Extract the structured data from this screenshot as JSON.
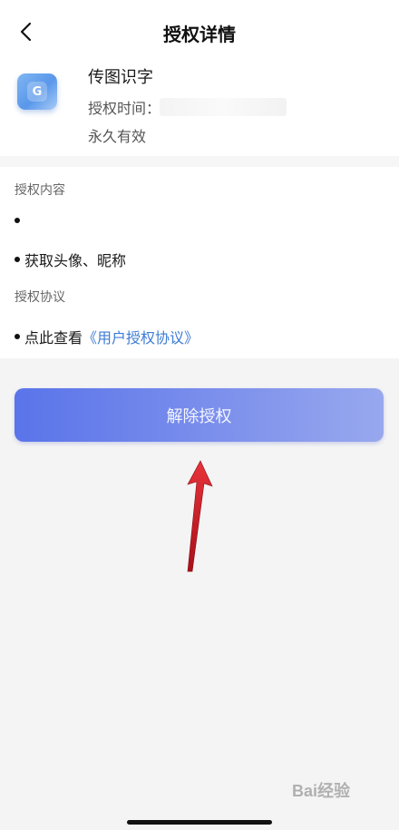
{
  "nav": {
    "title": "授权详情",
    "back_icon": "chevron-left-icon"
  },
  "app": {
    "name": "传图识字",
    "auth_time_label": "授权时间：",
    "validity": "永久有效",
    "icon_letter": "G"
  },
  "content": {
    "section1_title": "授权内容",
    "section1_items": [
      "",
      "获取头像、昵称"
    ],
    "section2_title": "授权协议",
    "agreement_prefix": "点此查看",
    "agreement_link": "《用户授权协议》"
  },
  "action": {
    "revoke_label": "解除授权"
  },
  "watermark": "Bai经验",
  "colors": {
    "link": "#3c7bd4",
    "button_start": "#5a74ea",
    "button_end": "#98a8ee",
    "arrow": "#d0202a"
  }
}
